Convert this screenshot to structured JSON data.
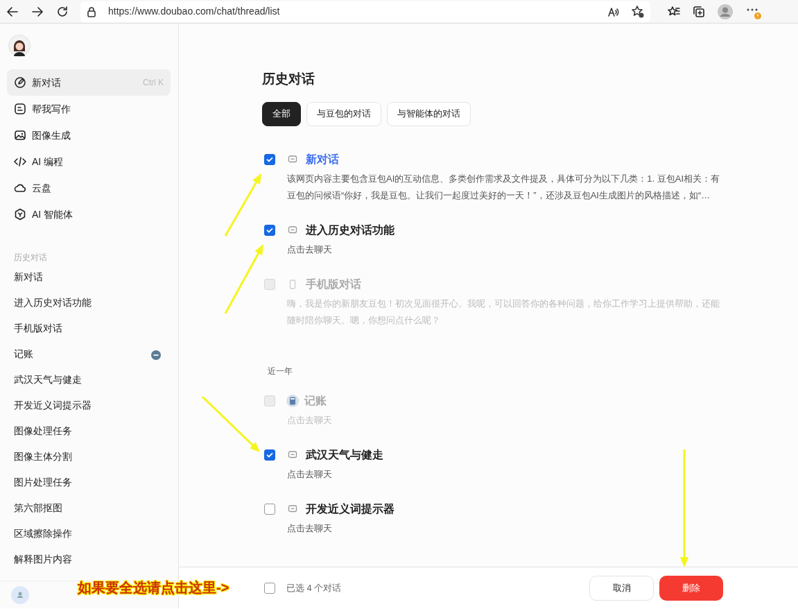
{
  "browser": {
    "url": "https://www.doubao.com/chat/thread/list"
  },
  "sidebar": {
    "nav": [
      {
        "label": "新对话",
        "kind": "edit",
        "shortcut": "Ctrl K",
        "selected": true
      },
      {
        "label": "帮我写作",
        "kind": "write",
        "selected": false
      },
      {
        "label": "图像生成",
        "kind": "image",
        "selected": false
      },
      {
        "label": "AI 编程",
        "kind": "code",
        "selected": false
      },
      {
        "label": "云盘",
        "kind": "cloud",
        "selected": false
      },
      {
        "label": "AI 智能体",
        "kind": "agent",
        "selected": false
      }
    ],
    "history_label": "历史对话",
    "history": [
      {
        "label": "新对话",
        "indicator": false
      },
      {
        "label": "进入历史对话功能",
        "indicator": false
      },
      {
        "label": "手机版对话",
        "indicator": false
      },
      {
        "label": "记账",
        "indicator": true
      },
      {
        "label": "武汉天气与健走",
        "indicator": false
      },
      {
        "label": "开发近义词提示器",
        "indicator": false
      },
      {
        "label": "图像处理任务",
        "indicator": false
      },
      {
        "label": "图像主体分割",
        "indicator": false
      },
      {
        "label": "图片处理任务",
        "indicator": false
      },
      {
        "label": "第六部抠图",
        "indicator": false
      },
      {
        "label": "区域擦除操作",
        "indicator": false
      },
      {
        "label": "解释图片内容",
        "indicator": false
      }
    ]
  },
  "main": {
    "title": "历史对话",
    "tabs": [
      {
        "label": "全部",
        "selected": true
      },
      {
        "label": "与豆包的对话",
        "selected": false
      },
      {
        "label": "与智能体的对话",
        "selected": false
      }
    ],
    "groups": [
      {
        "items": [
          {
            "title": "新对话",
            "kind": "chat",
            "checked": true,
            "disabled": false,
            "highlighted": true,
            "description": "该网页内容主要包含豆包AI的互动信息、多类创作需求及文件提及，具体可分为以下几类：1. 豆包AI相关：有豆包的问候语“你好，我是豆包。让我们一起度过美好的一天！”，还涉及豆包AI生成图片的风格描述，如“…"
          },
          {
            "title": "进入历史对话功能",
            "kind": "chat",
            "checked": true,
            "disabled": false,
            "highlighted": false,
            "description": "点击去聊天"
          },
          {
            "title": "手机版对话",
            "kind": "phone",
            "checked": false,
            "disabled": true,
            "highlighted": false,
            "description": "嗨，我是你的新朋友豆包！初次见面很开心。我呢，可以回答你的各种问题，给你工作学习上提供帮助，还能随时陪你聊天。嗯，你想问点什么呢？"
          }
        ]
      },
      {
        "label": "近一年",
        "items": [
          {
            "title": "记账",
            "kind": "book",
            "checked": false,
            "disabled": true,
            "highlighted": false,
            "description": "点击去聊天"
          },
          {
            "title": "武汉天气与健走",
            "kind": "chat",
            "checked": true,
            "disabled": false,
            "highlighted": false,
            "description": "点击去聊天"
          },
          {
            "title": "开发近义词提示器",
            "kind": "chat",
            "checked": false,
            "disabled": false,
            "highlighted": false,
            "description": "点击去聊天"
          }
        ]
      }
    ],
    "footer": {
      "select_all": false,
      "count": "已选 4 个对话",
      "cancel": "取消",
      "delete": "删除"
    }
  },
  "annotation": {
    "caption": "如果要全选请点击这里->"
  }
}
